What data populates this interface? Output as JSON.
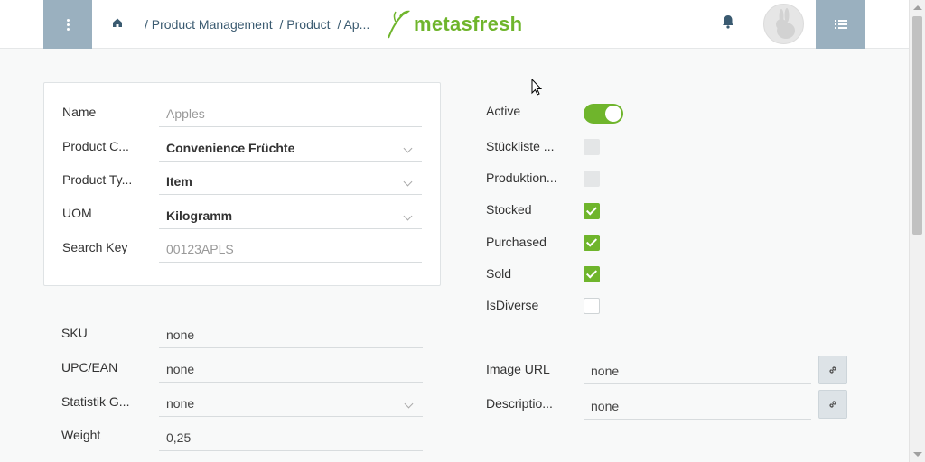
{
  "breadcrumb": {
    "items": [
      "/ Product Management",
      "/ Product",
      "/ Ap..."
    ]
  },
  "logo": {
    "text": "metasfresh"
  },
  "colors": {
    "accent": "#6fb52c",
    "sidebar_button": "#9ab0bf"
  },
  "icons": [
    "menu-icon",
    "home-icon",
    "bell-icon",
    "avatar-rabbit-icon",
    "list-icon",
    "link-icon"
  ],
  "form": {
    "name": {
      "label": "Name",
      "value": "Apples"
    },
    "product_category": {
      "label": "Product C...",
      "value": "Convenience Früchte"
    },
    "product_type": {
      "label": "Product Ty...",
      "value": "Item"
    },
    "uom": {
      "label": "UOM",
      "value": "Kilogramm"
    },
    "search_key": {
      "label": "Search Key",
      "value": "00123APLS"
    },
    "sku": {
      "label": "SKU",
      "value": "none"
    },
    "upc": {
      "label": "UPC/EAN",
      "value": "none"
    },
    "statistik": {
      "label": "Statistik G...",
      "value": "none"
    },
    "weight": {
      "label": "Weight",
      "value": "0,25"
    },
    "active": {
      "label": "Active",
      "value": true
    },
    "stueckliste": {
      "label": "Stückliste ...",
      "value": false
    },
    "produktion": {
      "label": "Produktion...",
      "value": false
    },
    "stocked": {
      "label": "Stocked",
      "value": true
    },
    "purchased": {
      "label": "Purchased",
      "value": true
    },
    "sold": {
      "label": "Sold",
      "value": true
    },
    "isdiverse": {
      "label": "IsDiverse",
      "value": false
    },
    "image_url": {
      "label": "Image URL",
      "value": "none"
    },
    "description": {
      "label": "Descriptio...",
      "value": "none"
    }
  }
}
